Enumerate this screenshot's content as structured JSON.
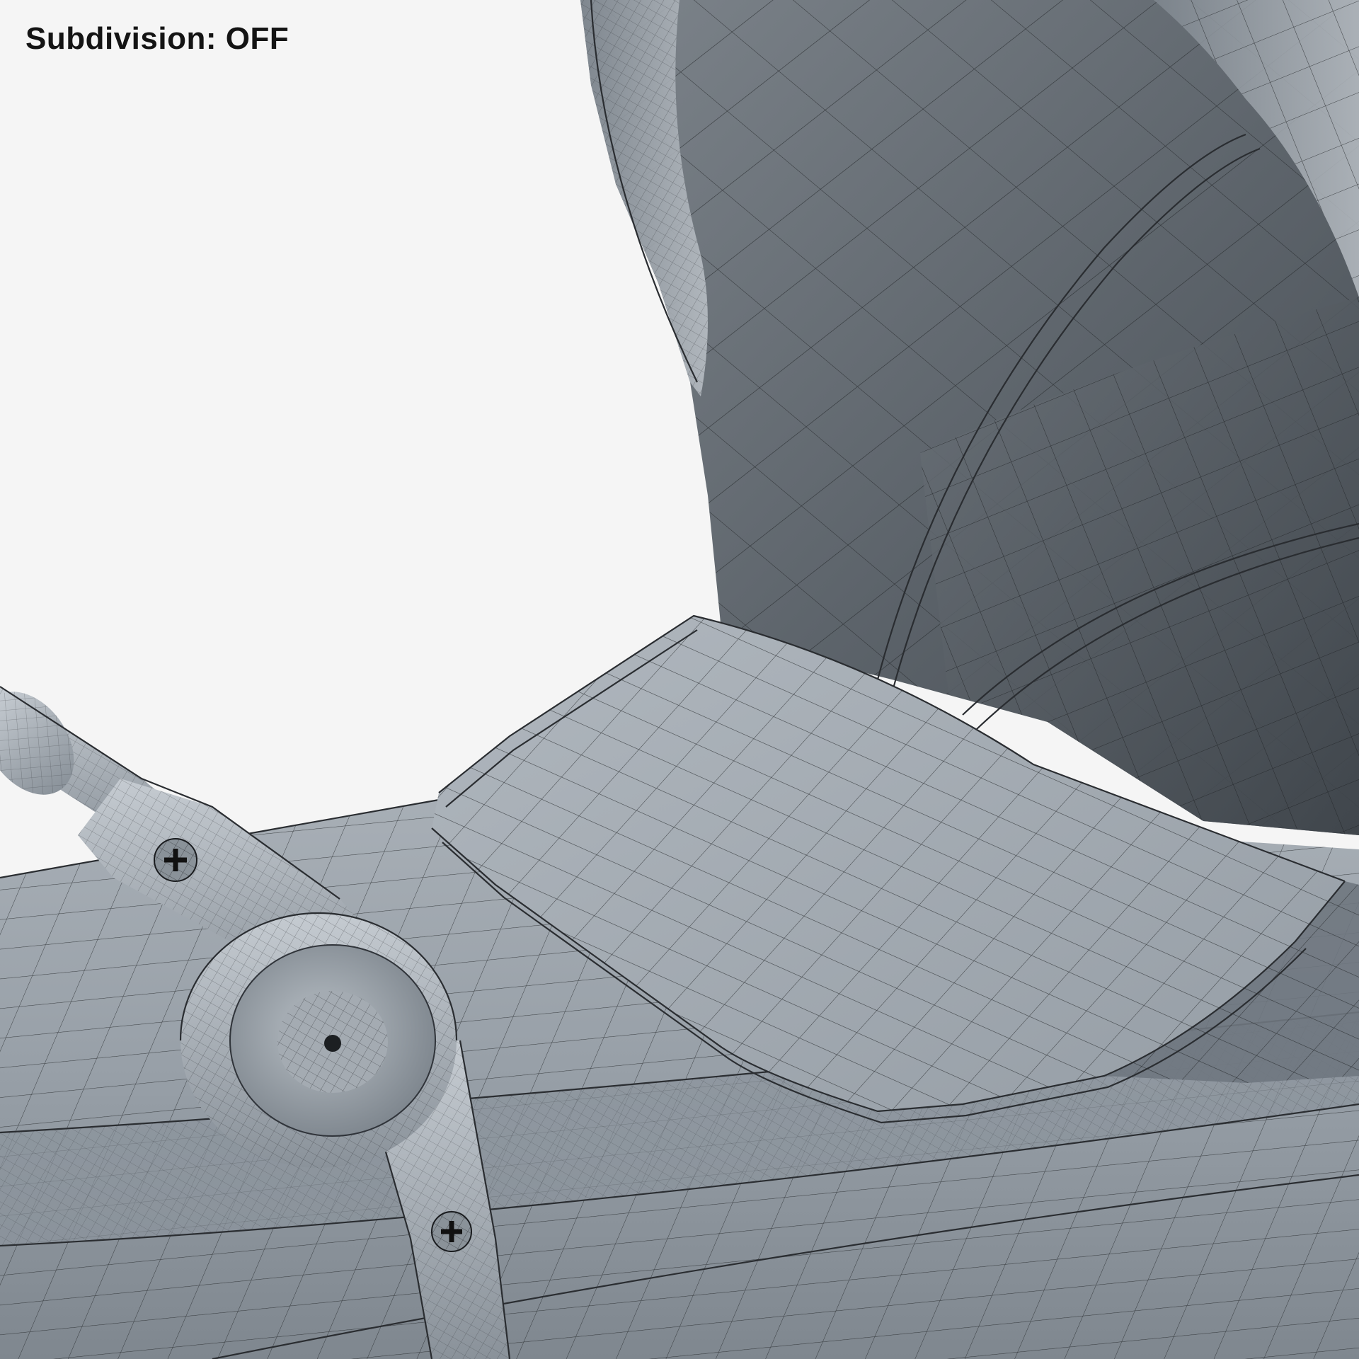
{
  "overlay": {
    "subdivision_label": "Subdivision: OFF"
  },
  "scene": {
    "background_color": "#f5f5f5",
    "mesh_color_light": "#9aa2aa",
    "mesh_color_dark": "#50565d",
    "wire_color": "#1e2124",
    "objects": [
      "canopy-hood",
      "seat-footrest",
      "base-tray",
      "handle-bar",
      "hinge-joint",
      "screw-head"
    ]
  }
}
